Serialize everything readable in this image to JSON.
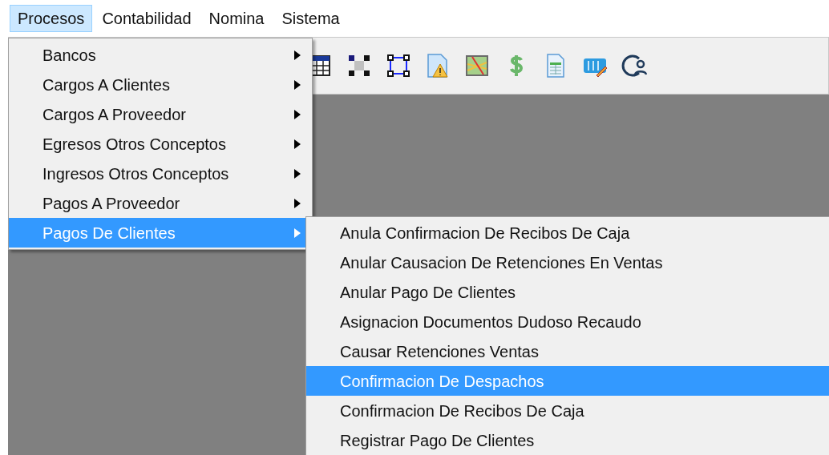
{
  "menu_bar": [
    {
      "label": "Procesos",
      "selected": true
    },
    {
      "label": "Contabilidad",
      "selected": false
    },
    {
      "label": "Nomina",
      "selected": false
    },
    {
      "label": "Sistema",
      "selected": false
    }
  ],
  "toolbar": {
    "items": [
      {
        "kind": "grid"
      },
      {
        "kind": "handles"
      },
      {
        "kind": "frame"
      },
      {
        "kind": "warning"
      },
      {
        "kind": "map"
      },
      {
        "kind": "dollar"
      },
      {
        "kind": "sheet"
      },
      {
        "kind": "panel"
      },
      {
        "kind": "coin"
      }
    ]
  },
  "menu": {
    "items": [
      {
        "label": "Bancos",
        "selected": false,
        "has_submenu": true
      },
      {
        "label": "Cargos A Clientes",
        "selected": false,
        "has_submenu": true
      },
      {
        "label": "Cargos A Proveedor",
        "selected": false,
        "has_submenu": true
      },
      {
        "label": "Egresos Otros Conceptos",
        "selected": false,
        "has_submenu": true
      },
      {
        "label": "Ingresos Otros Conceptos",
        "selected": false,
        "has_submenu": true
      },
      {
        "label": "Pagos A Proveedor",
        "selected": false,
        "has_submenu": true
      },
      {
        "label": "Pagos De Clientes",
        "selected": true,
        "has_submenu": true
      }
    ]
  },
  "submenu": {
    "items": [
      {
        "label": "Anula Confirmacion De Recibos De Caja",
        "selected": false
      },
      {
        "label": "Anular Causacion De Retenciones En Ventas",
        "selected": false
      },
      {
        "label": "Anular Pago De Clientes",
        "selected": false
      },
      {
        "label": "Asignacion Documentos Dudoso Recaudo",
        "selected": false
      },
      {
        "label": "Causar Retenciones Ventas",
        "selected": false
      },
      {
        "label": "Confirmacion De Despachos",
        "selected": true
      },
      {
        "label": "Confirmacion De Recibos De Caja",
        "selected": false
      },
      {
        "label": "Registrar Pago De Clientes",
        "selected": false
      }
    ]
  }
}
